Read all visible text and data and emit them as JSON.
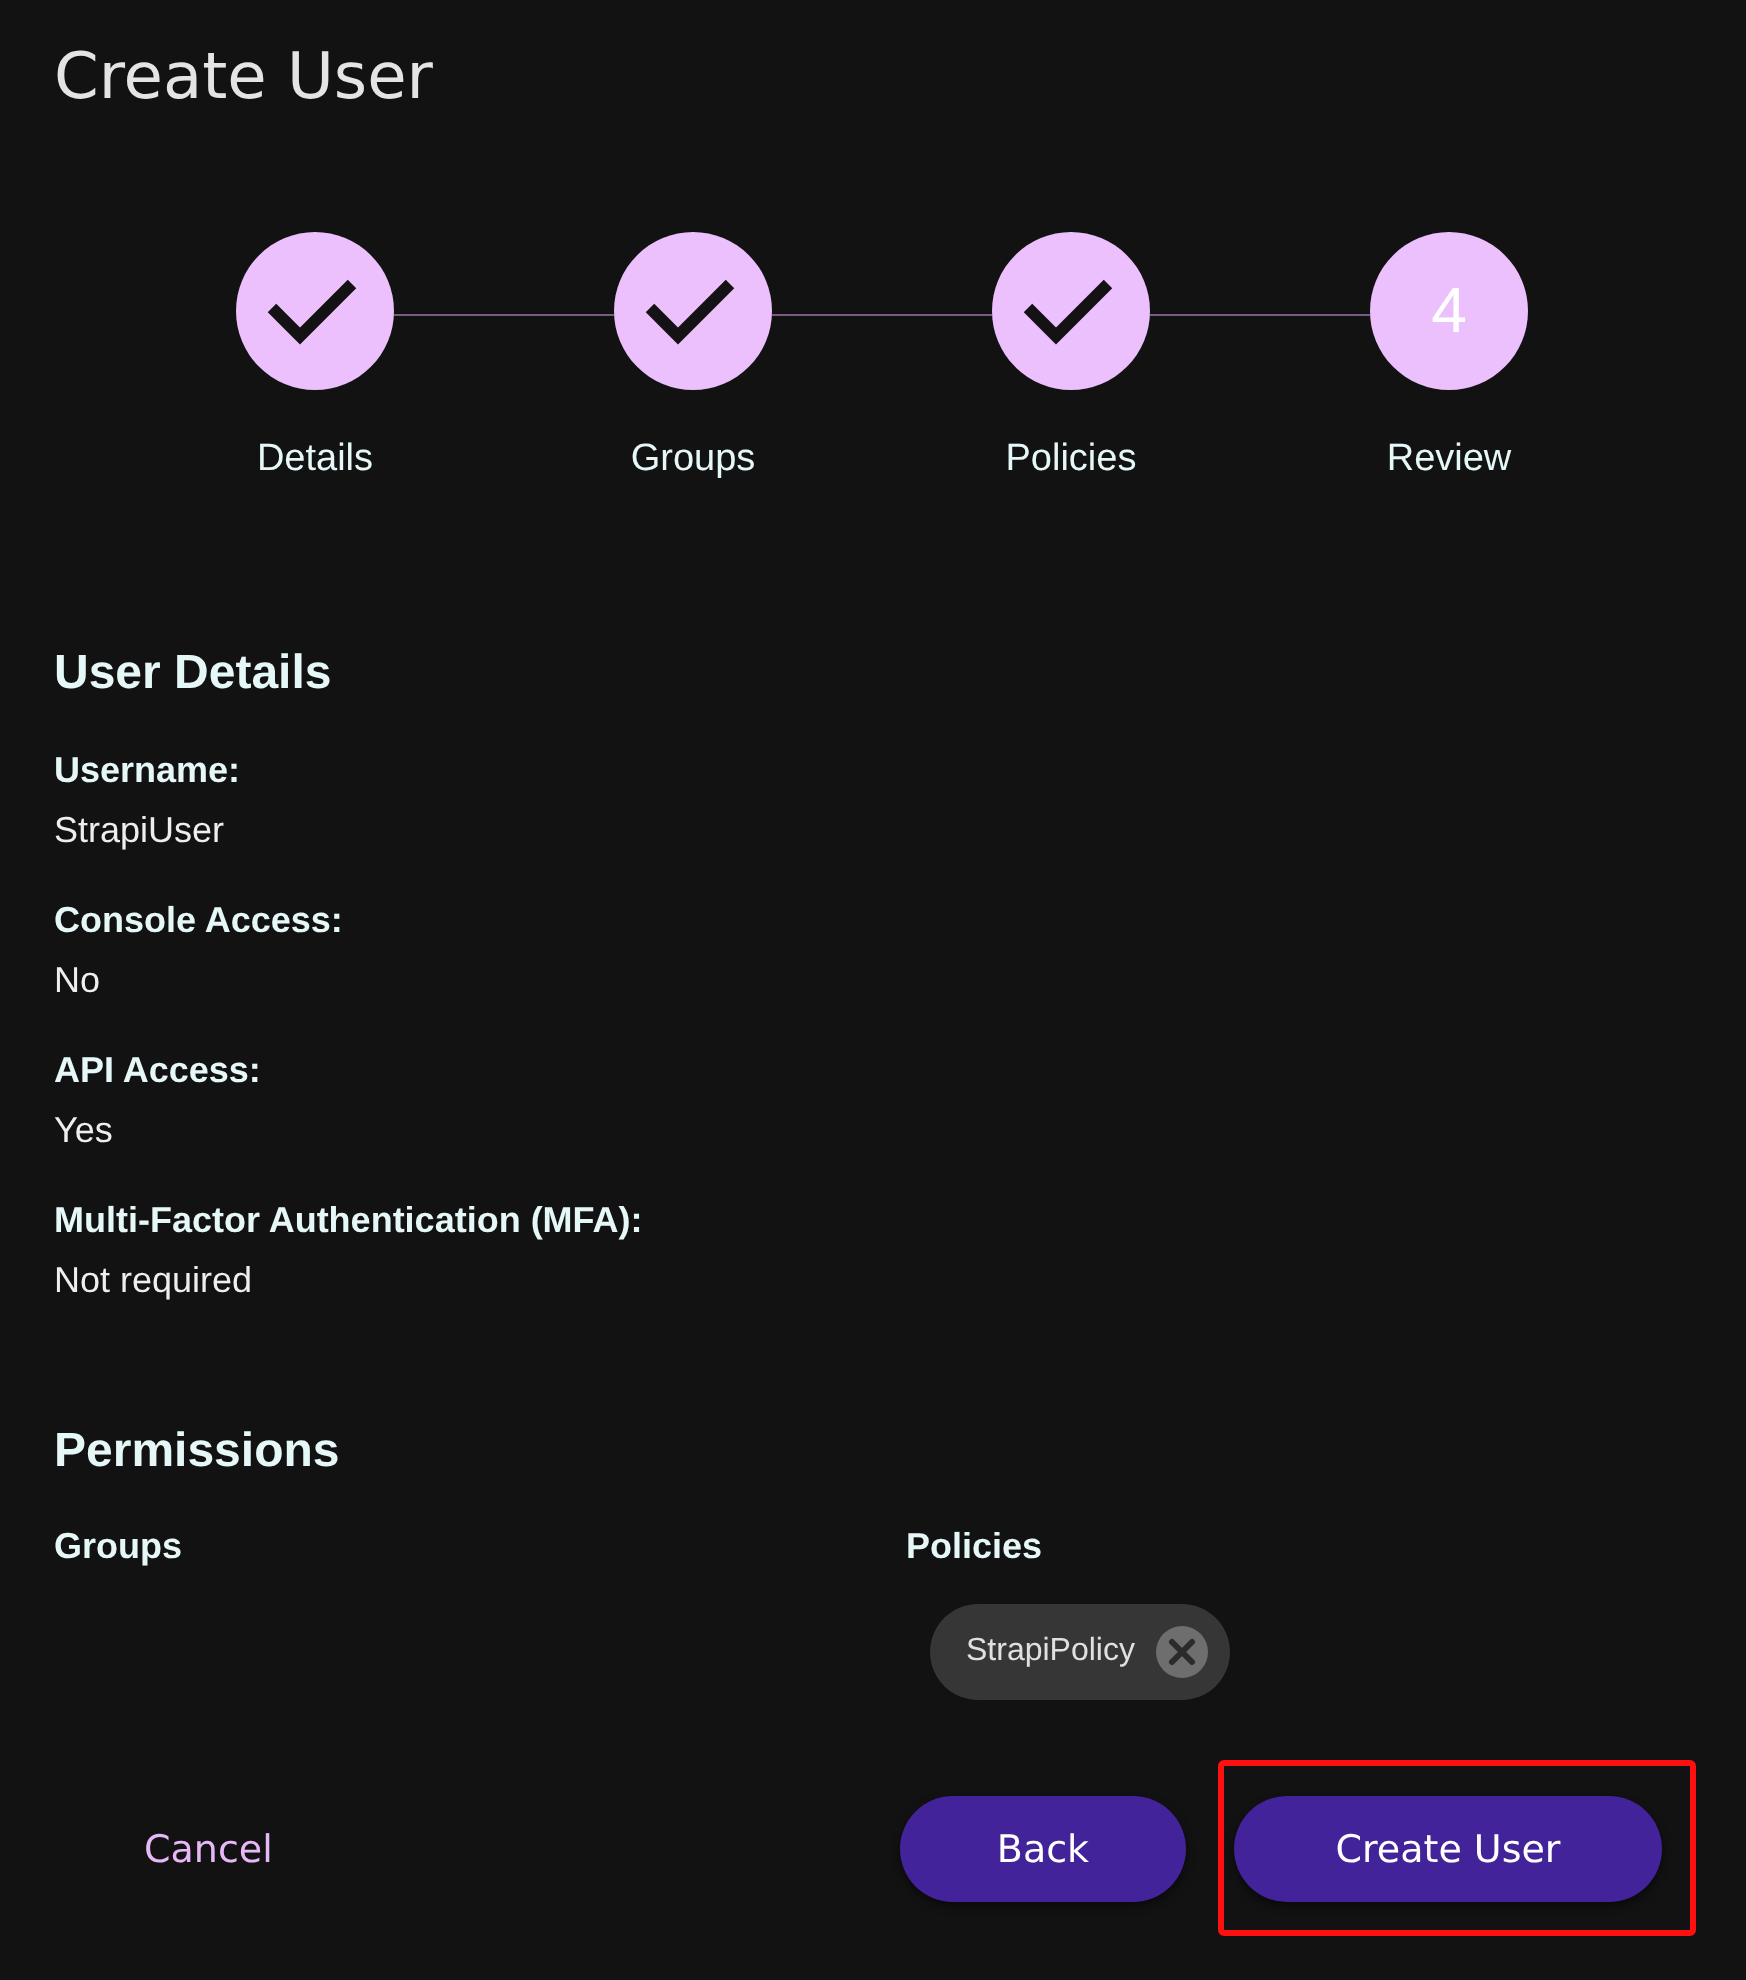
{
  "page": {
    "title": "Create User"
  },
  "stepper": {
    "steps": [
      {
        "label": "Details",
        "completed": true
      },
      {
        "label": "Groups",
        "completed": true
      },
      {
        "label": "Policies",
        "completed": true
      },
      {
        "label": "Review",
        "completed": false,
        "number": "4"
      }
    ]
  },
  "user_details": {
    "heading": "User Details",
    "fields": [
      {
        "label": "Username:",
        "value": "StrapiUser"
      },
      {
        "label": "Console Access:",
        "value": "No"
      },
      {
        "label": "API Access:",
        "value": "Yes"
      },
      {
        "label": "Multi-Factor Authentication (MFA):",
        "value": "Not required"
      }
    ]
  },
  "permissions": {
    "heading": "Permissions",
    "columns": [
      {
        "heading": "Groups"
      },
      {
        "heading": "Policies",
        "chips": [
          {
            "label": "StrapiPolicy"
          }
        ]
      }
    ]
  },
  "actions": {
    "cancel": "Cancel",
    "back": "Back",
    "create": {
      "label": "Create User",
      "highlighted": true
    }
  }
}
